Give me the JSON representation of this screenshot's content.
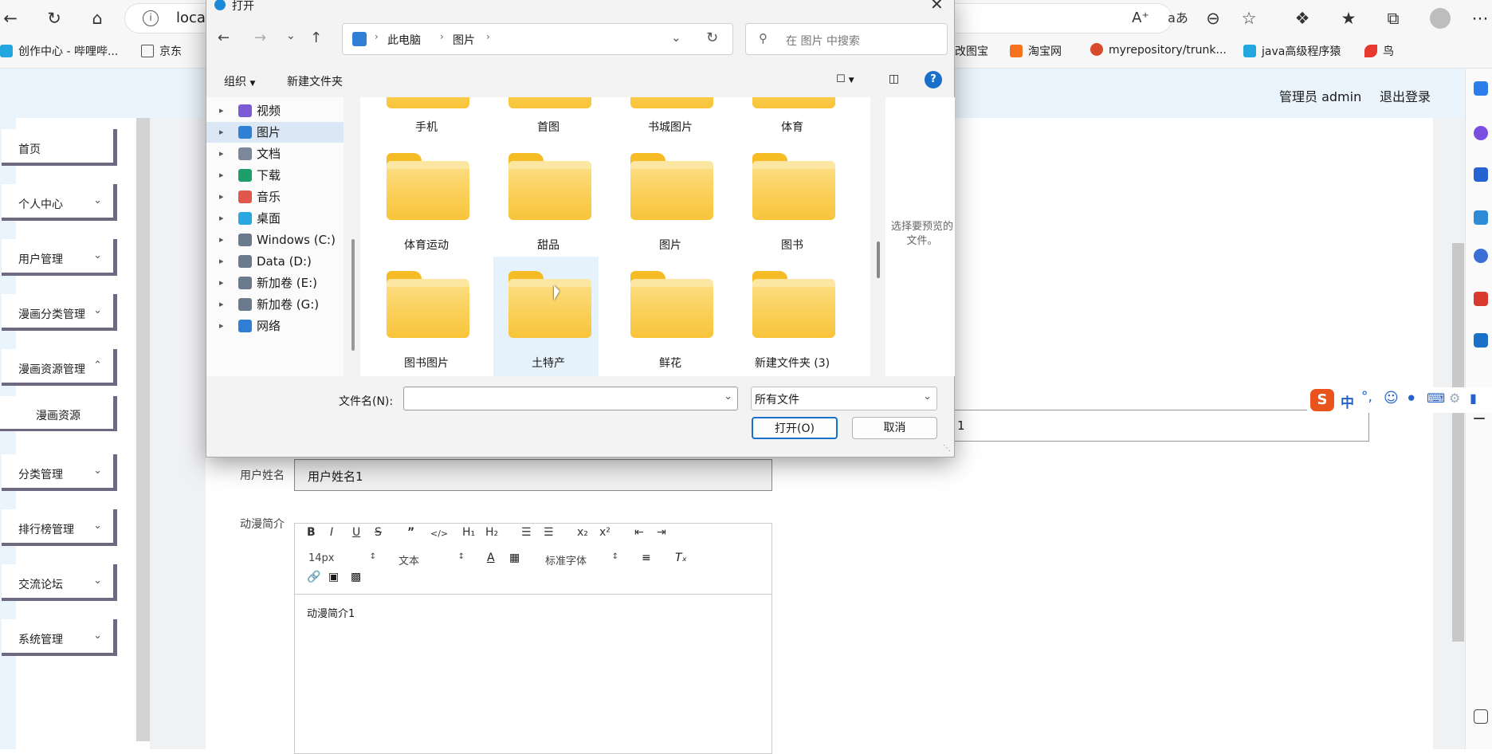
{
  "browser": {
    "address_text": "local",
    "bookmarks": [
      "创作中心 - 哔哩哔...",
      "京东",
      "改图宝",
      "淘宝网",
      "myrepository/trunk...",
      "java高级程序猿",
      "鸟"
    ]
  },
  "app": {
    "header_user": "管理员 admin",
    "header_logout": "退出登录",
    "sidebar": {
      "items": [
        {
          "label": "首页"
        },
        {
          "label": "个人中心"
        },
        {
          "label": "用户管理"
        },
        {
          "label": "漫画分类管理"
        },
        {
          "label": "漫画资源管理"
        },
        {
          "label": "漫画资源"
        },
        {
          "label": "分类管理"
        },
        {
          "label": "排行榜管理"
        },
        {
          "label": "交流论坛"
        },
        {
          "label": "系统管理"
        }
      ]
    },
    "form": {
      "hidden_field_value": "1",
      "username_label": "用户姓名",
      "username_value": "用户姓名1",
      "intro_label": "动漫简介",
      "intro_value": "动漫简介1",
      "toolbar": {
        "font_size": "14px",
        "paragraph": "文本",
        "font_family": "标准字体"
      }
    }
  },
  "ime": {
    "label": "中"
  },
  "dialog": {
    "title": "打开",
    "breadcrumb": [
      "此电脑",
      "图片"
    ],
    "search_placeholder": "在 图片 中搜索",
    "organize": "组织",
    "new_folder": "新建文件夹",
    "tree": [
      {
        "label": "视频",
        "color": "#7b5cd6"
      },
      {
        "label": "图片",
        "color": "#2f7fd6"
      },
      {
        "label": "文档",
        "color": "#7a8899"
      },
      {
        "label": "下载",
        "color": "#1e9e6a"
      },
      {
        "label": "音乐",
        "color": "#e2574c"
      },
      {
        "label": "桌面",
        "color": "#2aa7e0"
      },
      {
        "label": "Windows (C:)",
        "color": "#6b7a8c"
      },
      {
        "label": "Data (D:)",
        "color": "#6b7a8c"
      },
      {
        "label": "新加卷 (E:)",
        "color": "#6b7a8c"
      },
      {
        "label": "新加卷 (G:)",
        "color": "#6b7a8c"
      },
      {
        "label": "网络",
        "color": "#2f7fd6"
      }
    ],
    "folders_top_row": [
      "手机",
      "首图",
      "书城图片",
      "体育"
    ],
    "folders_row2": [
      "体育运动",
      "甜品",
      "图片",
      "图书"
    ],
    "folders_row3": [
      "图书图片",
      "土特产",
      "鲜花",
      "新建文件夹 (3)"
    ],
    "preview_text": "选择要预览的文件。",
    "filename_label": "文件名(N):",
    "filename_value": "",
    "filetype_value": "所有文件",
    "open_button": "打开(O)",
    "cancel_button": "取消"
  }
}
